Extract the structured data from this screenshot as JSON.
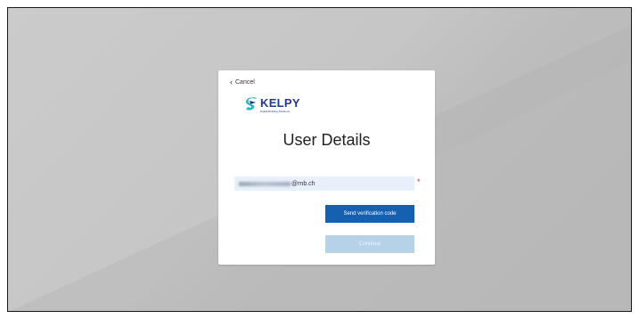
{
  "card": {
    "cancel_label": "Cancel",
    "logo": {
      "brand": "KELPY",
      "tagline": "Digital Building Solutions"
    },
    "title": "User Details",
    "email": {
      "value_visible": "@rnb.ch",
      "required_marker": "*"
    },
    "send_code_label": "Send verification code",
    "continue_label": "Continue"
  },
  "colors": {
    "primary_button": "#1560b0",
    "disabled_button": "#b6d2e9",
    "input_background": "#e8f0fb",
    "required": "#d6281d",
    "brand": "#1f3b8a"
  }
}
